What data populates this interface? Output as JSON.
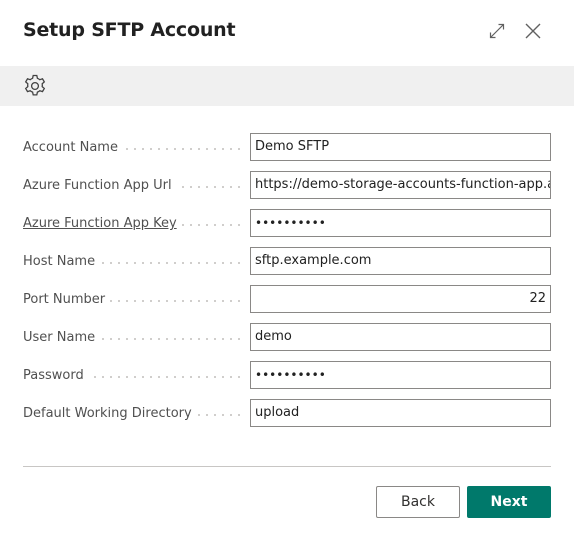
{
  "dialog": {
    "title": "Setup SFTP Account"
  },
  "header": {
    "expand_icon": "expand-arrows-icon",
    "close_icon": "close-icon"
  },
  "action_bar": {
    "icon": "gear-icon"
  },
  "fields": [
    {
      "label": "Account Name",
      "value": "Demo SFTP"
    },
    {
      "label": "Azure Function App Url",
      "value": "https://demo-storage-accounts-function-app.azurewebsites.net"
    },
    {
      "label": "Azure Function App Key",
      "value": "••••••••••"
    },
    {
      "label": "Host Name",
      "value": "sftp.example.com"
    },
    {
      "label": "Port Number",
      "value": "22"
    },
    {
      "label": "User Name",
      "value": "demo"
    },
    {
      "label": "Password",
      "value": "••••••••••"
    },
    {
      "label": "Default Working Directory",
      "value": "upload"
    }
  ],
  "footer": {
    "back_label": "Back",
    "next_label": "Next"
  },
  "colors": {
    "accent": "#00796b",
    "action_bar_bg": "#f0f0f0",
    "input_border": "#8a8886"
  }
}
